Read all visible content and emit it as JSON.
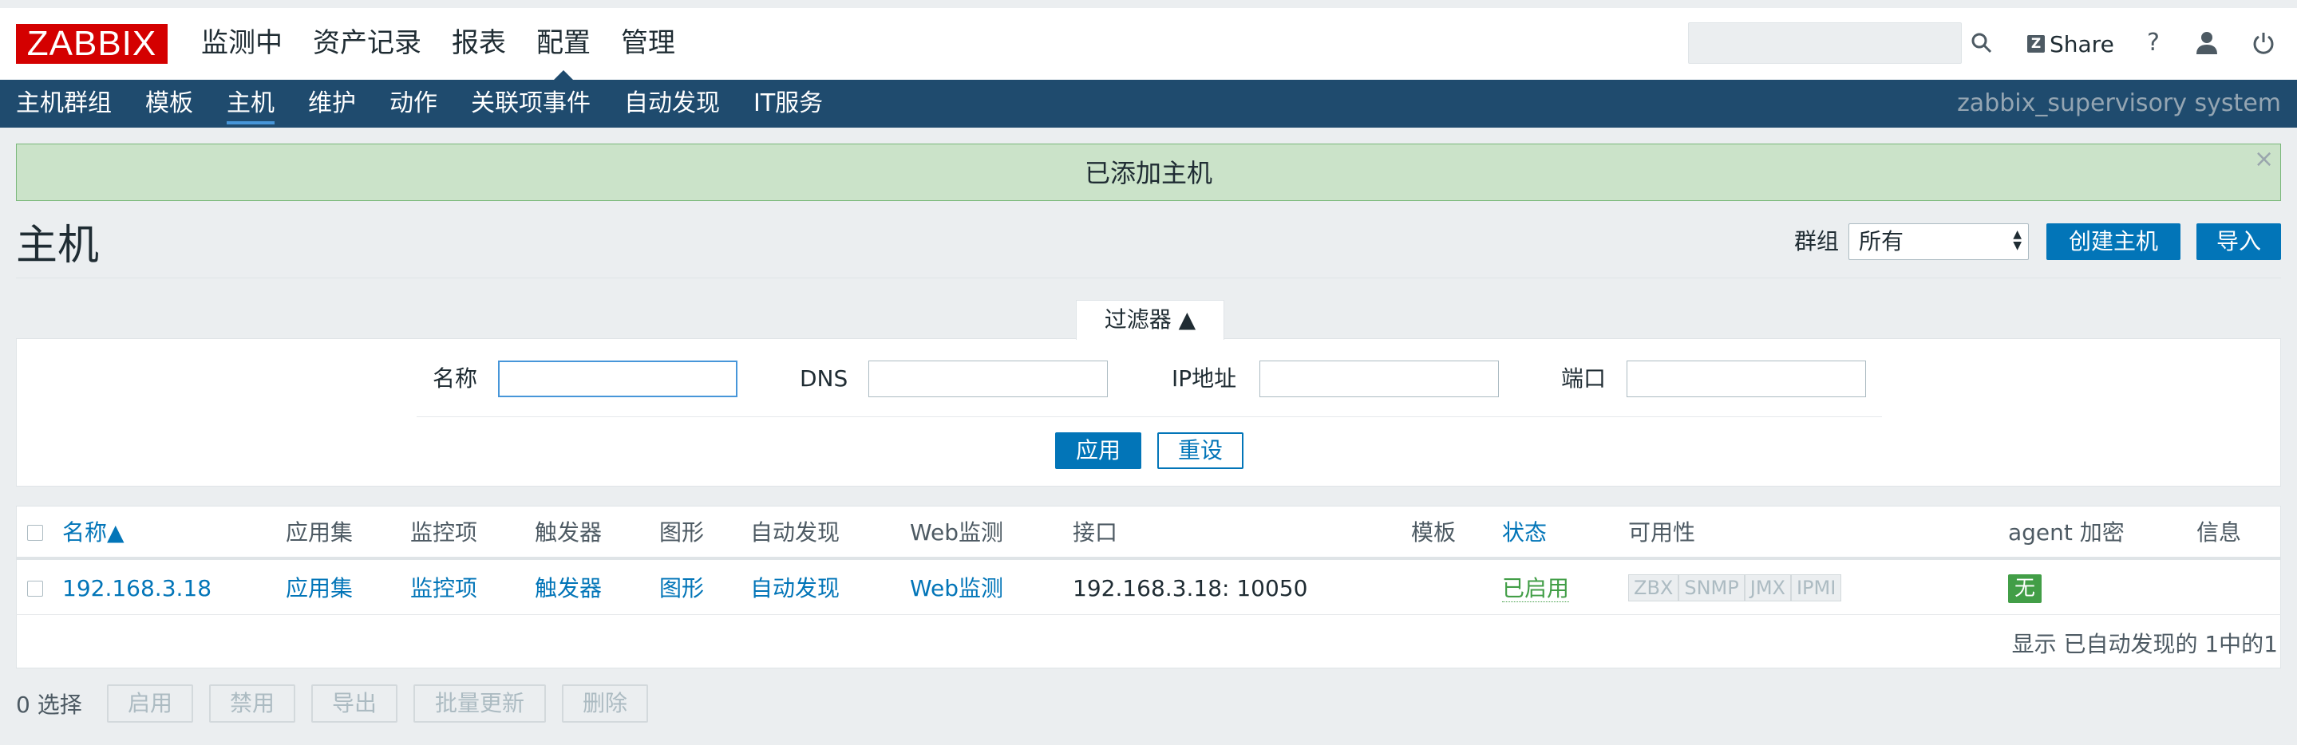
{
  "header": {
    "logo": "ZABBIX",
    "menu": [
      "监测中",
      "资产记录",
      "报表",
      "配置",
      "管理"
    ],
    "active_menu": "配置",
    "search_value": "",
    "share_label": "Share",
    "help_label": "?"
  },
  "subnav": {
    "items": [
      "主机群组",
      "模板",
      "主机",
      "维护",
      "动作",
      "关联项事件",
      "自动发现",
      "IT服务"
    ],
    "active": "主机",
    "system_name": "zabbix_supervisory system"
  },
  "message": {
    "text": "已添加主机",
    "close": "×"
  },
  "page": {
    "title": "主机",
    "group_label": "群组",
    "group_value": "所有",
    "create_button": "创建主机",
    "import_button": "导入"
  },
  "filter": {
    "tab_label": "过滤器 ▲",
    "name_label": "名称",
    "name_value": "",
    "dns_label": "DNS",
    "dns_value": "",
    "ip_label": "IP地址",
    "ip_value": "",
    "port_label": "端口",
    "port_value": "",
    "apply_button": "应用",
    "reset_button": "重设"
  },
  "table": {
    "headers": {
      "name": "名称▲",
      "applications": "应用集",
      "items": "监控项",
      "triggers": "触发器",
      "graphs": "图形",
      "discovery": "自动发现",
      "web": "Web监测",
      "interface": "接口",
      "templates": "模板",
      "status": "状态",
      "availability": "可用性",
      "encryption": "agent 加密",
      "info": "信息"
    },
    "rows": [
      {
        "name": "192.168.3.18",
        "applications": "应用集",
        "items": "监控项",
        "triggers": "触发器",
        "graphs": "图形",
        "discovery": "自动发现",
        "web": "Web监测",
        "interface": "192.168.3.18: 10050",
        "templates": "",
        "status": "已启用",
        "availability": [
          "ZBX",
          "SNMP",
          "JMX",
          "IPMI"
        ],
        "encryption": "无",
        "info": ""
      }
    ],
    "footer": "显示 已自动发现的 1中的1"
  },
  "actions": {
    "selected": "0 选择",
    "enable": "启用",
    "disable": "禁用",
    "export": "导出",
    "mass_update": "批量更新",
    "delete": "删除"
  },
  "colors": {
    "brand_red": "#d40000",
    "nav_blue": "#1f4b6e",
    "link_blue": "#0275b8",
    "success_green": "#429e47",
    "message_bg": "#cbe3c9"
  }
}
